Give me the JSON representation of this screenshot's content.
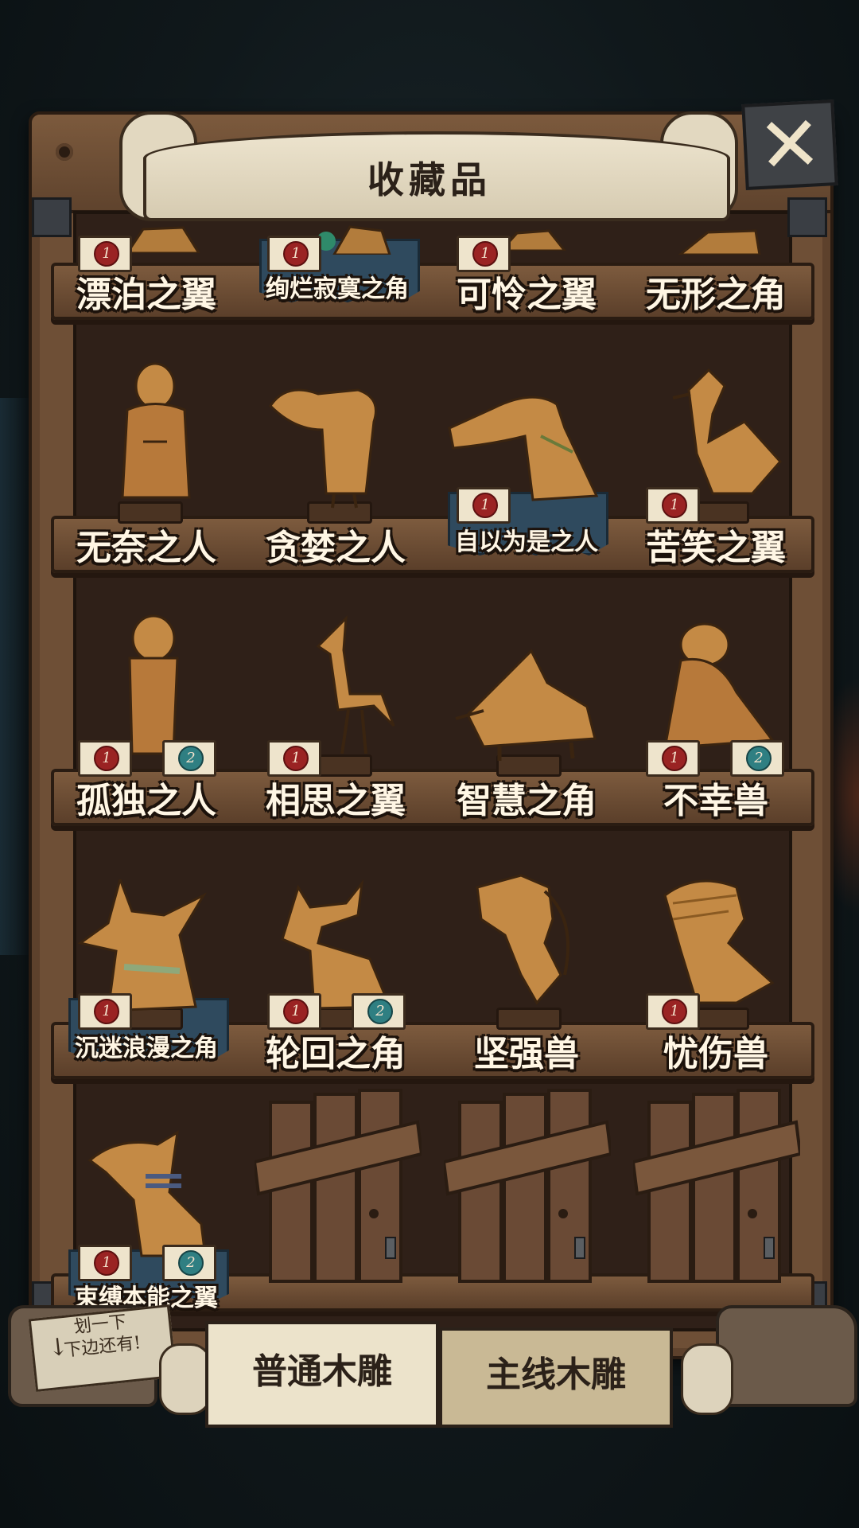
{
  "title": "收藏品",
  "close_label": "✕",
  "rows": [
    {
      "items": [
        {
          "label": "漂泊之翼",
          "selected": false
        },
        {
          "label": "绚烂寂寞之角",
          "selected": true
        },
        {
          "label": "可怜之翼",
          "selected": false
        },
        {
          "label": "无形之角",
          "selected": false
        }
      ]
    },
    {
      "items": [
        {
          "label": "无奈之人",
          "selected": false
        },
        {
          "label": "贪婪之人",
          "selected": false
        },
        {
          "label": "自以为是之人",
          "selected": true
        },
        {
          "label": "苦笑之翼",
          "selected": false
        }
      ]
    },
    {
      "items": [
        {
          "label": "孤独之人",
          "selected": false
        },
        {
          "label": "相思之翼",
          "selected": false
        },
        {
          "label": "智慧之角",
          "selected": false
        },
        {
          "label": "不幸兽",
          "selected": false
        }
      ]
    },
    {
      "items": [
        {
          "label": "沉迷浪漫之角",
          "selected": true
        },
        {
          "label": "轮回之角",
          "selected": false
        },
        {
          "label": "坚强兽",
          "selected": false
        },
        {
          "label": "忧伤兽",
          "selected": false
        }
      ]
    },
    {
      "items": [
        {
          "label": "束缚本能之翼",
          "selected": true
        },
        {
          "label": "",
          "locked": true
        },
        {
          "label": "",
          "locked": true
        },
        {
          "label": "",
          "locked": true
        }
      ]
    }
  ],
  "badges": {
    "one": "1",
    "two": "2"
  },
  "hint": {
    "line1": "划一下",
    "line2": "下边还有!"
  },
  "tabs": {
    "normal": "普通木雕",
    "main": "主线木雕",
    "active": "normal"
  },
  "colors": {
    "wood": "#6e4f36",
    "shelf_bg": "#2f2018",
    "selected_tag": "#2f4a5e",
    "label_text": "#fff6e4",
    "seal_red": "#9a2323",
    "seal_teal": "#2f7f82"
  }
}
